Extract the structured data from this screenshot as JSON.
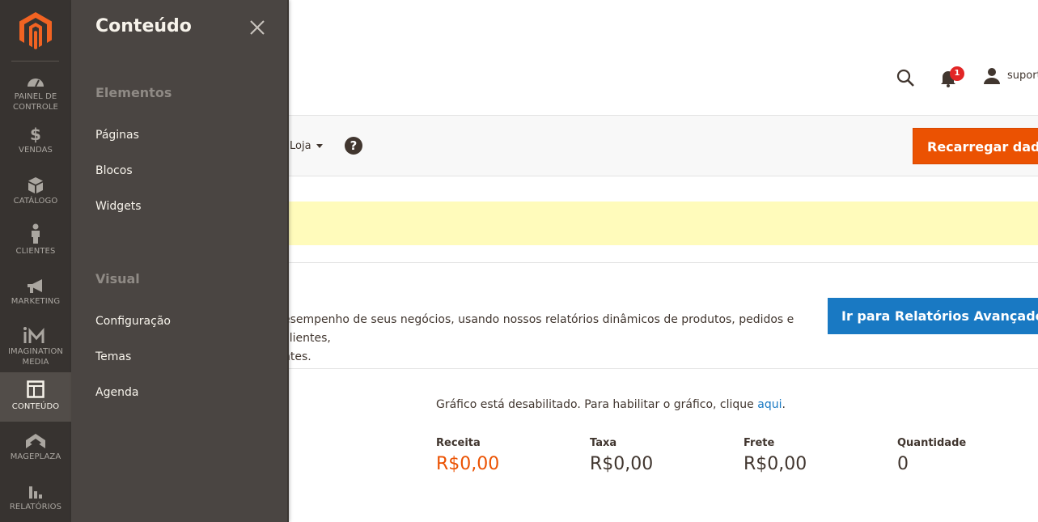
{
  "nav": {
    "items": [
      {
        "label": "PAINEL DE CONTROLE",
        "line1": "PAINEL DE",
        "line2": "CONTROLE",
        "icon": "dashboard-icon"
      },
      {
        "label": "VENDAS",
        "icon": "dollar-icon"
      },
      {
        "label": "CATÁLOGO",
        "icon": "box-icon"
      },
      {
        "label": "CLIENTES",
        "icon": "person-icon"
      },
      {
        "label": "MARKETING",
        "icon": "megaphone-icon"
      },
      {
        "label": "IMAGINATION MEDIA",
        "line1": "IMAGINATION",
        "line2": "MEDIA",
        "icon": "im-logo-icon"
      },
      {
        "label": "CONTEÚDO",
        "icon": "layout-icon",
        "active": true
      },
      {
        "label": "MAGEPLAZA",
        "icon": "mageplaza-icon"
      },
      {
        "label": "RELATÓRIOS",
        "icon": "bar-chart-icon"
      }
    ]
  },
  "submenu": {
    "title": "Conteúdo",
    "sections": [
      {
        "title": "Elementos",
        "links": [
          "Páginas",
          "Blocos",
          "Widgets"
        ]
      },
      {
        "title": "Visual",
        "links": [
          "Configuração",
          "Temas",
          "Agenda"
        ]
      }
    ]
  },
  "header": {
    "notifications_count": "1",
    "user_name": "suport"
  },
  "actions": {
    "store_switcher": "Loja",
    "help": "?",
    "reload_label": "Recarregar dados"
  },
  "advanced": {
    "text_line1": "esempenho de seus negócios, usando nossos relatórios dinâmicos de produtos, pedidos e clientes,",
    "text_line2": "ntes.",
    "button_label": "Ir para Relatórios Avançados"
  },
  "chart_notice": {
    "text": "Gráfico está desabilitado. Para habilitar o gráfico, clique ",
    "link": "aqui",
    "suffix": "."
  },
  "totals": [
    {
      "label": "Receita",
      "value": "R$0,00"
    },
    {
      "label": "Taxa",
      "value": "R$0,00"
    },
    {
      "label": "Frete",
      "value": "R$0,00"
    },
    {
      "label": "Quantidade",
      "value": "0"
    }
  ],
  "colors": {
    "menu_bg": "#373330",
    "submenu_bg": "#4a4542",
    "accent_orange": "#eb5202",
    "primary_blue": "#1979c3",
    "notice_yellow": "#fffbbb"
  }
}
